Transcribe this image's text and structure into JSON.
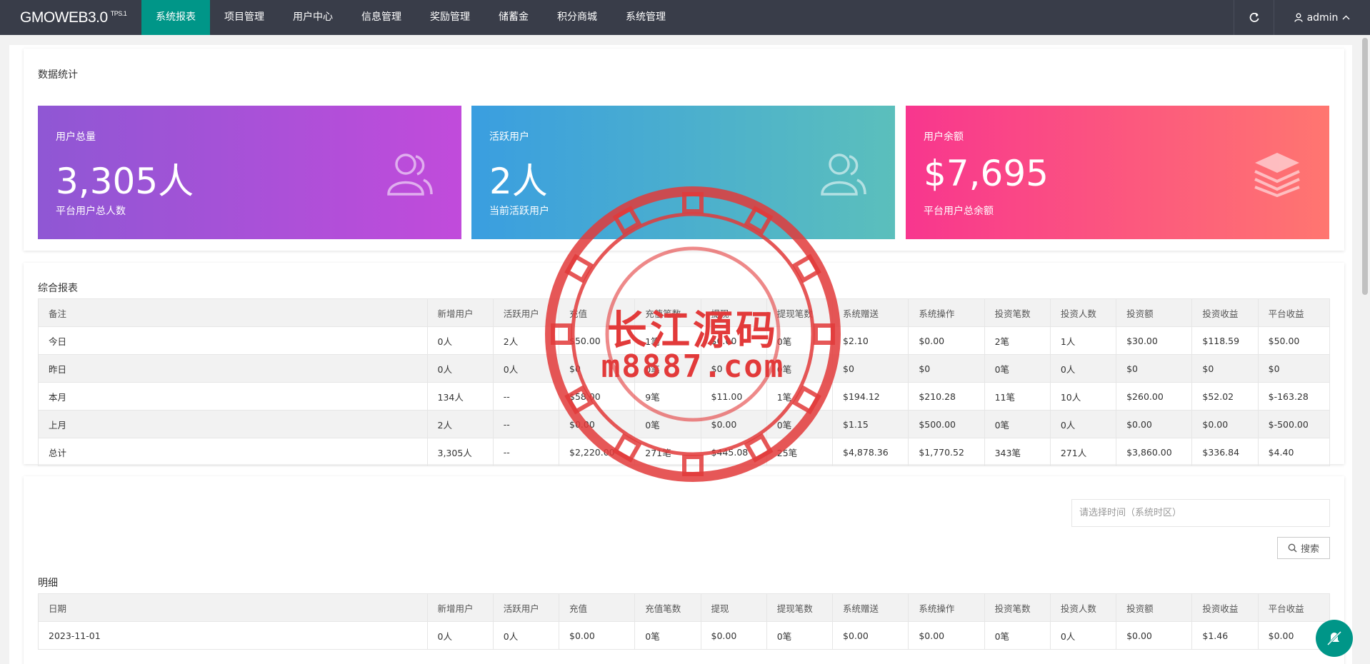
{
  "app": {
    "logo": "GMOWEB3.0",
    "logo_sup": "TPS.1"
  },
  "nav": {
    "items": [
      "系统报表",
      "项目管理",
      "用户中心",
      "信息管理",
      "奖励管理",
      "储蓄金",
      "积分商城",
      "系统管理"
    ],
    "active_index": 0,
    "user": "admin"
  },
  "stats_section": {
    "title": "数据统计",
    "cards": [
      {
        "label": "用户总量",
        "value": "3,305人",
        "sub": "平台用户总人数",
        "icon": "users-icon"
      },
      {
        "label": "活跃用户",
        "value": "2人",
        "sub": "当前活跃用户",
        "icon": "users-icon"
      },
      {
        "label": "用户余额",
        "value": "$7,695",
        "sub": "平台用户总余额",
        "icon": "layers-icon"
      }
    ]
  },
  "report": {
    "title": "综合报表",
    "columns": [
      "备注",
      "新增用户",
      "活跃用户",
      "充值",
      "充值笔数",
      "提现",
      "提现笔数",
      "系统赠送",
      "系统操作",
      "投资笔数",
      "投资人数",
      "投资额",
      "投资收益",
      "平台收益"
    ],
    "rows": [
      [
        "今日",
        "0人",
        "2人",
        "$50.00",
        "1笔",
        "$0.00",
        "0笔",
        "$2.10",
        "$0.00",
        "2笔",
        "1人",
        "$30.00",
        "$118.59",
        "$50.00"
      ],
      [
        "昨日",
        "0人",
        "0人",
        "$0",
        "0笔",
        "$0",
        "0笔",
        "$0",
        "$0",
        "0笔",
        "0人",
        "$0",
        "$0",
        "$0"
      ],
      [
        "本月",
        "134人",
        "--",
        "$58.00",
        "9笔",
        "$11.00",
        "1笔",
        "$194.12",
        "$210.28",
        "11笔",
        "10人",
        "$260.00",
        "$52.02",
        "$-163.28"
      ],
      [
        "上月",
        "2人",
        "--",
        "$0.00",
        "0笔",
        "$0.00",
        "0笔",
        "$1.15",
        "$500.00",
        "0笔",
        "0人",
        "$0.00",
        "$0.00",
        "$-500.00"
      ],
      [
        "总计",
        "3,305人",
        "--",
        "$2,220.00",
        "271笔",
        "$445.08",
        "25笔",
        "$4,878.36",
        "$1,770.52",
        "343笔",
        "271人",
        "$3,860.00",
        "$336.84",
        "$4.40"
      ]
    ]
  },
  "detail": {
    "title": "明细",
    "date_placeholder": "请选择时间（系统时区）",
    "search_label": "搜索",
    "columns": [
      "日期",
      "新增用户",
      "活跃用户",
      "充值",
      "充值笔数",
      "提现",
      "提现笔数",
      "系统赠送",
      "系统操作",
      "投资笔数",
      "投资人数",
      "投资额",
      "投资收益",
      "平台收益"
    ],
    "rows": [
      [
        "2023-11-01",
        "0人",
        "0人",
        "$0.00",
        "0笔",
        "$0.00",
        "0笔",
        "$0.00",
        "$0.00",
        "0笔",
        "0人",
        "$0.00",
        "$1.46",
        "$0.00"
      ]
    ]
  },
  "watermark": {
    "title": "长江源码",
    "url": "m8887.com"
  },
  "colors": {
    "topbar": "#393d49",
    "nav_active": "#009688",
    "card1": [
      "#8f57d4",
      "#c14bdb"
    ],
    "card2": [
      "#3a9ee0",
      "#5bbfbc"
    ],
    "card3": [
      "#f8368e",
      "#ff7670"
    ],
    "watermark": "#e23a3a"
  }
}
